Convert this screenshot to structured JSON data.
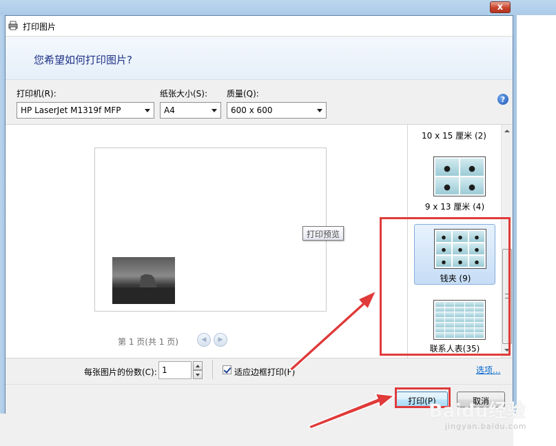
{
  "window": {
    "title": "打印图片",
    "close_label": "x"
  },
  "header": {
    "question": "您希望如何打印图片?"
  },
  "options": {
    "printer_label": "打印机(R):",
    "printer_value": "HP LaserJet M1319f MFP",
    "paper_label": "纸张大小(S):",
    "paper_value": "A4",
    "quality_label": "质量(Q):",
    "quality_value": "600 x 600",
    "help_label": "?"
  },
  "preview": {
    "tooltip": "打印预览",
    "pager": "第 1 页(共 1 页)"
  },
  "layouts": {
    "items": [
      {
        "label": "10 x 15 厘米 (2)"
      },
      {
        "label": "9 x 13 厘米 (4)"
      },
      {
        "label": "钱夹 (9)",
        "selected": true
      },
      {
        "label": "联系人表(35)"
      }
    ]
  },
  "bottom": {
    "copies_label": "每张图片的份数(C):",
    "copies_value": "1",
    "fit_label": "适应边框打印(F)",
    "fit_checked": true,
    "options_link": "选项..."
  },
  "footer": {
    "print_label": "打印(P)",
    "cancel_label": "取消"
  },
  "watermark": {
    "main": "Baidu经验",
    "sub": "jingyan.baidu.com"
  },
  "colors": {
    "annotation": "#e03a3a",
    "link": "#0066cc",
    "question": "#1e3287"
  }
}
